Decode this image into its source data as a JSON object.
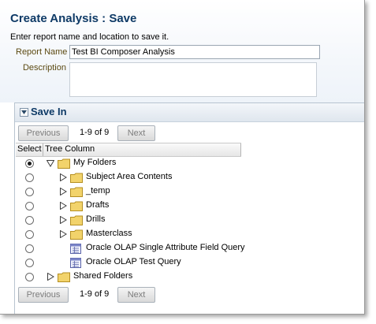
{
  "dialog": {
    "title": "Create Analysis : Save",
    "subtitle": "Enter report name and location to save it.",
    "report_name_label": "Report Name",
    "report_name_value": "Test BI Composer Analysis",
    "description_label": "Description",
    "description_value": ""
  },
  "save_in": {
    "title": "Save In",
    "collapse_icon": "collapse-triangle-icon",
    "pager": {
      "previous_label": "Previous",
      "next_label": "Next",
      "page_text": "1-9 of 9"
    },
    "columns": {
      "select": "Select",
      "tree": "Tree Column"
    },
    "rows": [
      {
        "label": "My Folders",
        "selected": true,
        "expanded": true,
        "type": "folder"
      },
      {
        "label": "Subject Area Contents",
        "selected": false,
        "expanded": false,
        "type": "folder"
      },
      {
        "label": "_temp",
        "selected": false,
        "expanded": false,
        "type": "folder"
      },
      {
        "label": "Drafts",
        "selected": false,
        "expanded": false,
        "type": "folder"
      },
      {
        "label": "Drills",
        "selected": false,
        "expanded": false,
        "type": "folder"
      },
      {
        "label": "Masterclass",
        "selected": false,
        "expanded": false,
        "type": "folder"
      },
      {
        "label": "Oracle OLAP Single Attribute Field Query",
        "selected": false,
        "type": "query"
      },
      {
        "label": "Oracle OLAP Test Query",
        "selected": false,
        "type": "query"
      },
      {
        "label": "Shared Folders",
        "selected": false,
        "expanded": false,
        "type": "folder"
      }
    ]
  },
  "colors": {
    "title": "#0e3a66",
    "label": "#5c4a12",
    "folder": "#f2d36b",
    "folder_outline": "#b58f22"
  }
}
